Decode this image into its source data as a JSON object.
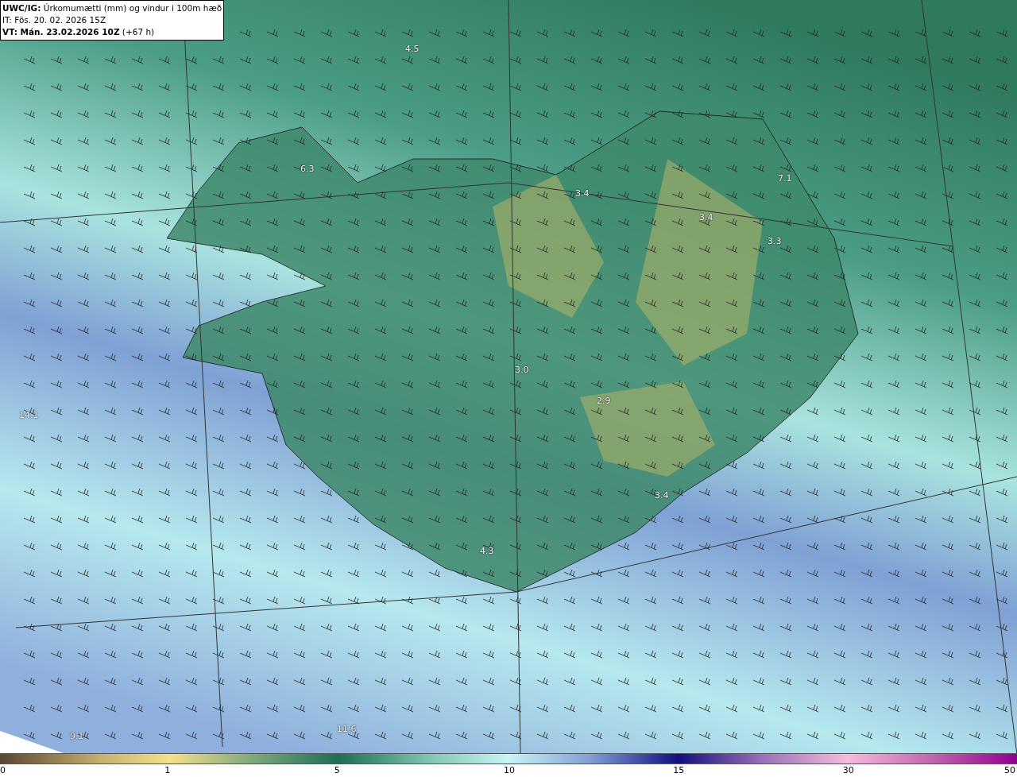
{
  "header": {
    "title": "**UWC/IG:** Úrkomumætti (mm) og vindur i 100m hæð",
    "initial_time": "IT: Fös. 20. 02. 2026 15Z",
    "valid_time": "**VT: Mán. 23.02.2026 10Z** (+67 h)"
  },
  "map_values": [
    "4.5",
    "6.3",
    "3.4",
    "3.4",
    "7.1",
    "3.3",
    "3.0",
    "2.9",
    "14.1",
    "3.4",
    "4.3",
    "9.1",
    "11.6"
  ],
  "colorbar": {
    "ticks": [
      "0",
      "1",
      "5",
      "10",
      "15",
      "30",
      "50"
    ]
  }
}
